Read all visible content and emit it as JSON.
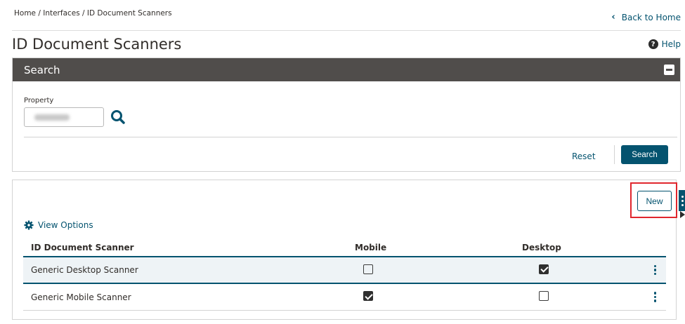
{
  "breadcrumb": "Home / Interfaces / ID Document Scanners",
  "back_link": "Back to Home",
  "page_title": "ID Document Scanners",
  "help_link": "Help",
  "search_panel": {
    "title": "Search",
    "property_label": "Property",
    "property_value": "",
    "reset_label": "Reset",
    "search_label": "Search"
  },
  "results": {
    "new_label": "New",
    "view_options_label": "View Options",
    "columns": [
      "ID Document Scanner",
      "Mobile",
      "Desktop"
    ],
    "rows": [
      {
        "name": "Generic Desktop Scanner",
        "mobile": false,
        "desktop": true
      },
      {
        "name": "Generic Mobile Scanner",
        "mobile": true,
        "desktop": false
      }
    ]
  },
  "colors": {
    "accent": "#04536f",
    "header_bg": "#504d4b",
    "highlight": "#e0262d"
  }
}
